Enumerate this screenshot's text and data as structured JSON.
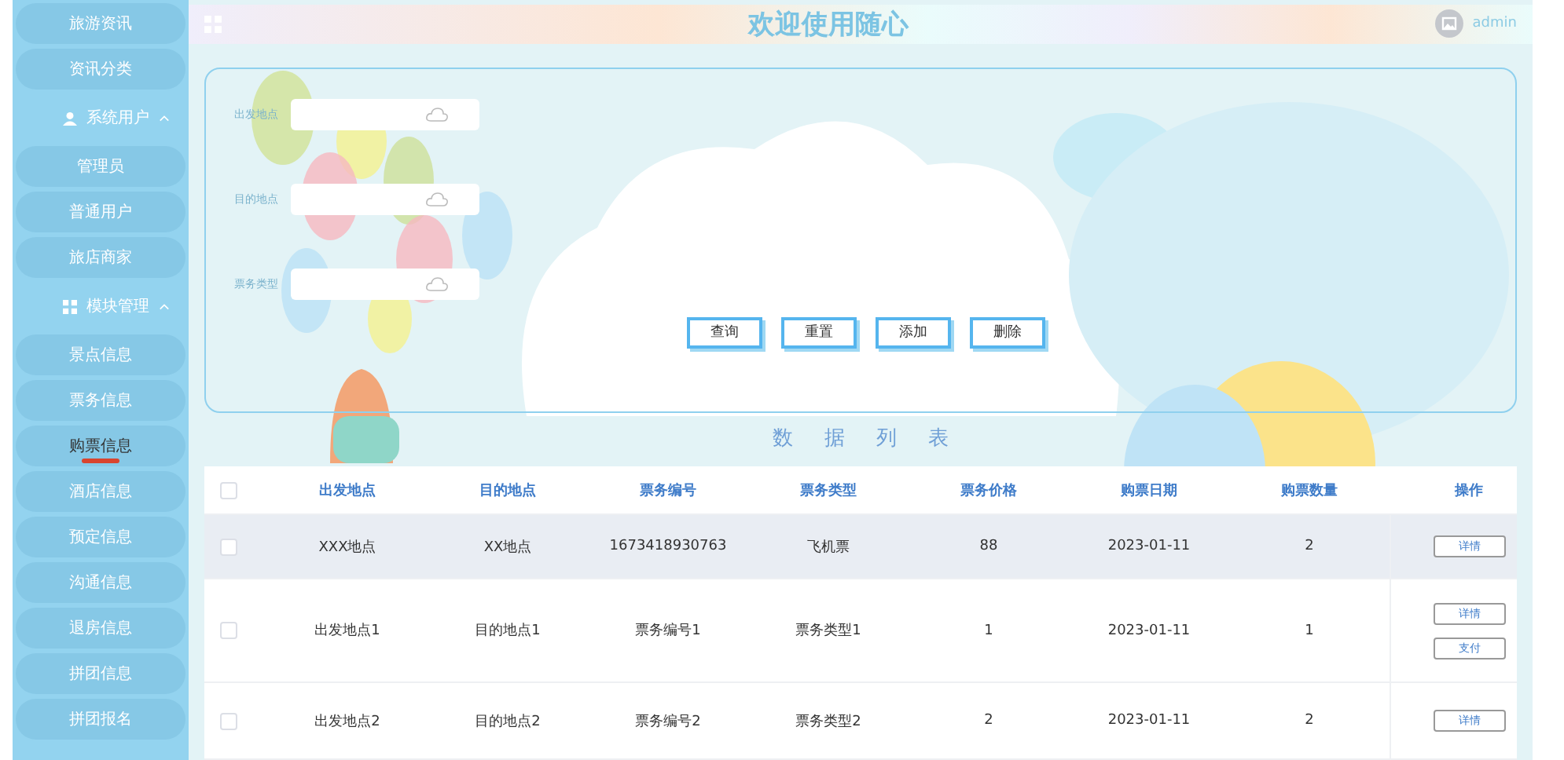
{
  "header": {
    "title": "欢迎使用随心",
    "user": "admin"
  },
  "sidebar": {
    "items": [
      {
        "kind": "item",
        "label": "旅游资讯",
        "selected": false
      },
      {
        "kind": "item",
        "label": "资讯分类",
        "selected": false
      },
      {
        "kind": "group",
        "label": "系统用户",
        "expanded": true
      },
      {
        "kind": "item",
        "label": "管理员",
        "selected": false
      },
      {
        "kind": "item",
        "label": "普通用户",
        "selected": false
      },
      {
        "kind": "item",
        "label": "旅店商家",
        "selected": false
      },
      {
        "kind": "group",
        "label": "模块管理",
        "expanded": true
      },
      {
        "kind": "item",
        "label": "景点信息",
        "selected": false
      },
      {
        "kind": "item",
        "label": "票务信息",
        "selected": false
      },
      {
        "kind": "item",
        "label": "购票信息",
        "selected": true
      },
      {
        "kind": "item",
        "label": "酒店信息",
        "selected": false
      },
      {
        "kind": "item",
        "label": "预定信息",
        "selected": false
      },
      {
        "kind": "item",
        "label": "沟通信息",
        "selected": false
      },
      {
        "kind": "item",
        "label": "退房信息",
        "selected": false
      },
      {
        "kind": "item",
        "label": "拼团信息",
        "selected": false
      },
      {
        "kind": "item",
        "label": "拼团报名",
        "selected": false
      }
    ]
  },
  "search": {
    "fields": [
      {
        "label": "出发地点"
      },
      {
        "label": "目的地点"
      },
      {
        "label": "票务类型"
      }
    ],
    "buttons": [
      "查询",
      "重置",
      "添加",
      "删除"
    ]
  },
  "table": {
    "title": "数据列表",
    "header_checked": false,
    "columns": [
      "出发地点",
      "目的地点",
      "票务编号",
      "票务类型",
      "票务价格",
      "购票日期",
      "购票数量",
      "操作"
    ],
    "rows": [
      {
        "checked": false,
        "selected": true,
        "cells": [
          "XXX地点",
          "XX地点",
          "1673418930763",
          "飞机票",
          "88",
          "2023-01-11",
          "2"
        ],
        "actions": [
          "详情"
        ]
      },
      {
        "checked": false,
        "selected": false,
        "cells": [
          "出发地点1",
          "目的地点1",
          "票务编号1",
          "票务类型1",
          "1",
          "2023-01-11",
          "1"
        ],
        "actions": [
          "详情",
          "支付"
        ]
      },
      {
        "checked": false,
        "selected": false,
        "cells": [
          "出发地点2",
          "目的地点2",
          "票务编号2",
          "票务类型2",
          "2",
          "2023-01-11",
          "2"
        ],
        "actions": [
          "详情"
        ]
      }
    ]
  }
}
